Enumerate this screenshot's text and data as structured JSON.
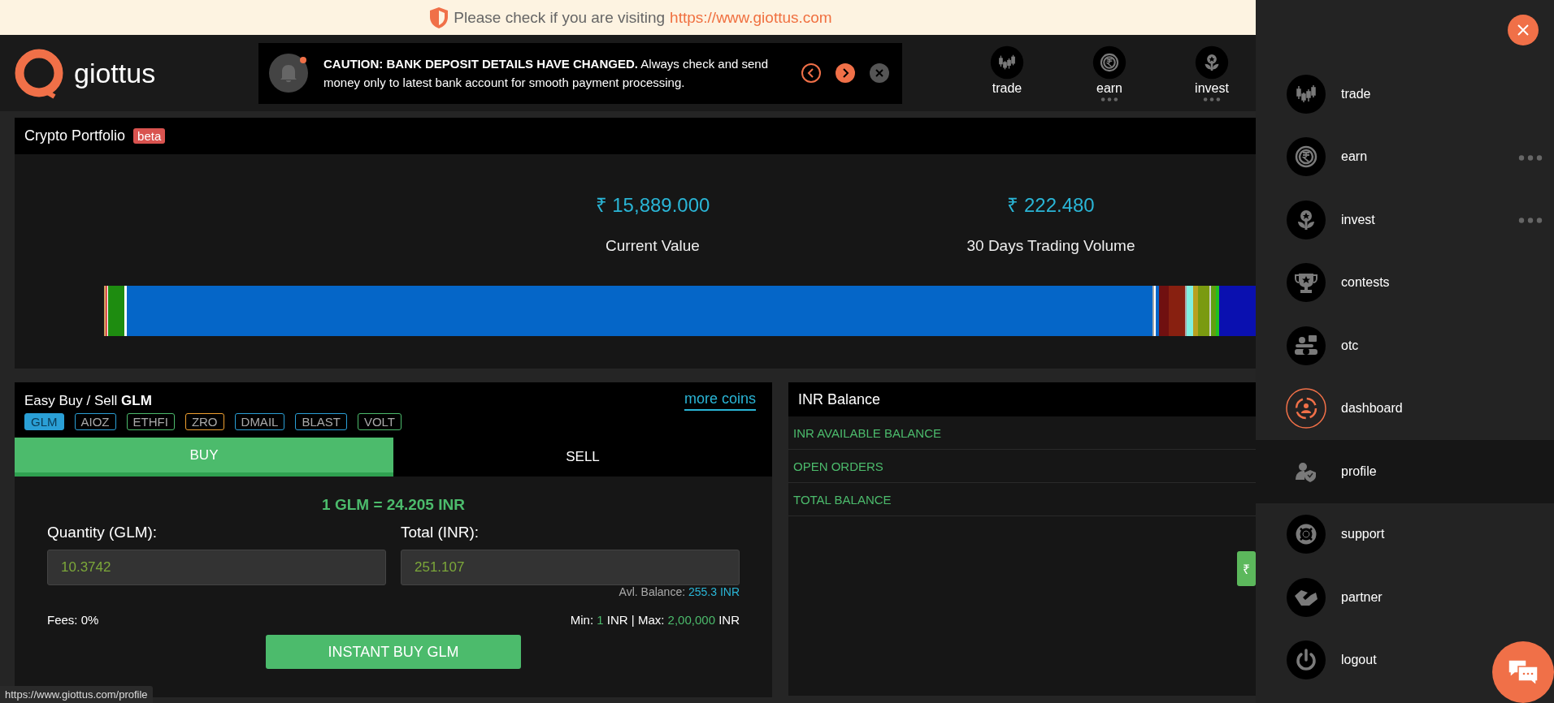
{
  "banner": {
    "text": "Please check if you are visiting",
    "url": "https://www.giottus.com"
  },
  "header": {
    "logo": "giottus",
    "notice": {
      "text": "**CAUTION: BANK DEPOSIT DETAILS HAVE CHANGED.** Always check and send money only to latest bank account for smooth payment processing.",
      "unread": true
    },
    "nav": [
      {
        "label": "trade",
        "has_more": false
      },
      {
        "label": "earn",
        "has_more": true
      },
      {
        "label": "invest",
        "has_more": true
      }
    ]
  },
  "portfolio": {
    "title": "Crypto Portfolio",
    "badge": "beta",
    "stats": [
      {
        "value": "₹ 15,889.000",
        "label": "Current Value"
      },
      {
        "value": "₹ 222.480",
        "label": "30 Days Trading Volume"
      }
    ]
  },
  "easy_trade": {
    "title": "Easy Buy / Sell **GLM**",
    "more_link": "more coins",
    "coins": [
      {
        "label": "GLM",
        "color": "#2a9fd6",
        "selected": true
      },
      {
        "label": "AIOZ",
        "color": "#2a9fd6",
        "selected": false
      },
      {
        "label": "ETHFI",
        "color": "#4cbb6c",
        "selected": false
      },
      {
        "label": "ZRO",
        "color": "#f0a030",
        "selected": false
      },
      {
        "label": "DMAIL",
        "color": "#2a9fd6",
        "selected": false
      },
      {
        "label": "BLAST",
        "color": "#2a9fd6",
        "selected": false
      },
      {
        "label": "VOLT",
        "color": "#4cbb6c",
        "selected": false
      }
    ],
    "tabs": [
      {
        "label": "BUY",
        "selected": true
      },
      {
        "label": "SELL",
        "selected": false
      }
    ],
    "rate": "1 GLM = 24.205 INR",
    "quantity": {
      "label": "Quantity (GLM):",
      "value": "10.3742"
    },
    "total": {
      "label": "Total (INR):",
      "value": "251.107"
    },
    "balance": {
      "label": "Avl. Balance:",
      "value": "255.3 INR"
    },
    "fees": "Fees: 0%",
    "limits": {
      "min_label": "Min:",
      "min": "1",
      "unit1": "INR |",
      "max_label": "Max:",
      "max": "2,00,000",
      "unit2": "INR"
    },
    "button": "INSTANT BUY GLM"
  },
  "inr_balance": {
    "title": "INR Balance",
    "rows": [
      "INR AVAILABLE BALANCE",
      "OPEN ORDERS",
      "TOTAL BALANCE"
    ],
    "deposit_tab": "₹"
  },
  "side_menu": {
    "items": [
      {
        "label": "trade",
        "has_more": false,
        "current": false,
        "selected": false
      },
      {
        "label": "earn",
        "has_more": true,
        "current": false,
        "selected": false
      },
      {
        "label": "invest",
        "has_more": true,
        "current": false,
        "selected": false
      },
      {
        "label": "contests",
        "has_more": false,
        "current": false,
        "selected": false
      },
      {
        "label": "otc",
        "has_more": false,
        "current": false,
        "selected": false
      },
      {
        "label": "dashboard",
        "has_more": false,
        "current": true,
        "selected": false
      },
      {
        "label": "profile",
        "has_more": false,
        "current": false,
        "selected": true
      },
      {
        "label": "support",
        "has_more": false,
        "current": false,
        "selected": false
      },
      {
        "label": "partner",
        "has_more": false,
        "current": false,
        "selected": false
      },
      {
        "label": "logout",
        "has_more": false,
        "current": false,
        "selected": false
      }
    ]
  },
  "status_bar": {
    "url": "https://www.giottus.com/profile"
  }
}
